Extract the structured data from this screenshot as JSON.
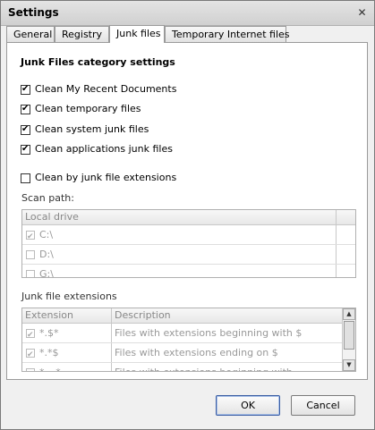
{
  "window": {
    "title": "Settings",
    "close_glyph": "✕"
  },
  "tabs": [
    {
      "label": "General"
    },
    {
      "label": "Registry"
    },
    {
      "label": "Junk files"
    },
    {
      "label": "Temporary Internet files"
    }
  ],
  "panel": {
    "heading": "Junk Files category settings",
    "options": [
      {
        "label": "Clean My Recent Documents",
        "checked": true
      },
      {
        "label": "Clean temporary files",
        "checked": true
      },
      {
        "label": "Clean system junk files",
        "checked": true
      },
      {
        "label": "Clean applications junk files",
        "checked": true
      },
      {
        "label": "Clean by junk file extensions",
        "checked": false
      }
    ],
    "scan_path": {
      "label": "Scan path:",
      "header": "Local drive",
      "drives": [
        {
          "name": "C:\\",
          "checked": true
        },
        {
          "name": "D:\\",
          "checked": false
        },
        {
          "name": "G:\\",
          "checked": false
        }
      ]
    },
    "extensions": {
      "label": "Junk file extensions",
      "col_extension": "Extension",
      "col_description": "Description",
      "rows": [
        {
          "ext": "*.$*",
          "desc": "Files with extensions beginning with $",
          "checked": true
        },
        {
          "ext": "*.*$",
          "desc": "Files with extensions ending on $",
          "checked": true
        },
        {
          "ext": "*.~*",
          "desc": "Files with extensions beginning with ~",
          "checked": true
        }
      ]
    }
  },
  "buttons": {
    "ok": "OK",
    "cancel": "Cancel"
  },
  "icons": {
    "scroll_up": "▲",
    "scroll_down": "▼"
  },
  "colors": {
    "default_button_border": "#3a5da3"
  }
}
